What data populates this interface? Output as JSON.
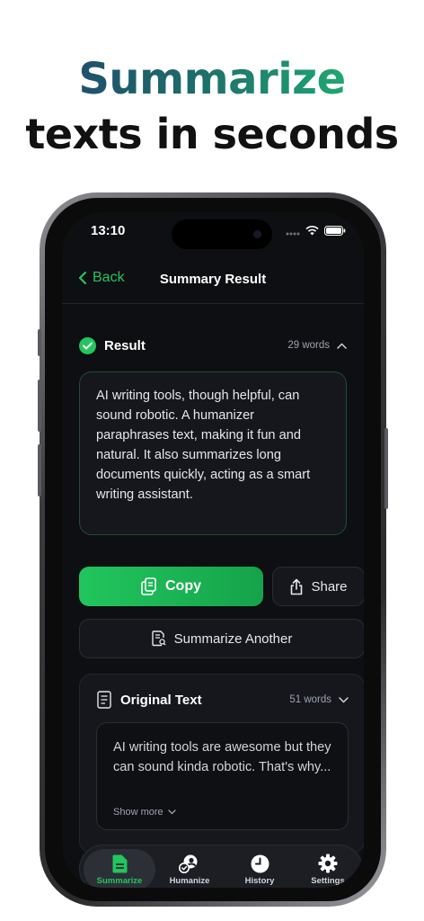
{
  "headline": {
    "line1": "Summarize",
    "line2": "texts in seconds"
  },
  "status_bar": {
    "time": "13:10"
  },
  "nav": {
    "back_label": "Back",
    "title": "Summary Result"
  },
  "result": {
    "label": "Result",
    "word_count": "29 words",
    "text": "AI writing tools, though helpful, can sound robotic. A humanizer paraphrases text, making it fun and natural. It also summarizes long documents quickly, acting as a smart writing assistant."
  },
  "actions": {
    "copy_label": "Copy",
    "share_label": "Share",
    "summarize_another_label": "Summarize Another"
  },
  "original": {
    "label": "Original Text",
    "word_count": "51 words",
    "text": "AI writing tools are awesome but they can sound kinda robotic. That's why...",
    "show_more_label": "Show more"
  },
  "tab_bar": {
    "tabs": [
      {
        "label": "Summarize",
        "icon": "document-icon",
        "active": true
      },
      {
        "label": "Humanize",
        "icon": "person-check-icon",
        "active": false
      },
      {
        "label": "History",
        "icon": "clock-icon",
        "active": false
      },
      {
        "label": "Settings",
        "icon": "gear-icon",
        "active": false
      }
    ]
  },
  "colors": {
    "accent": "#22c55e",
    "background": "#0e0f12",
    "card": "#15171d"
  }
}
